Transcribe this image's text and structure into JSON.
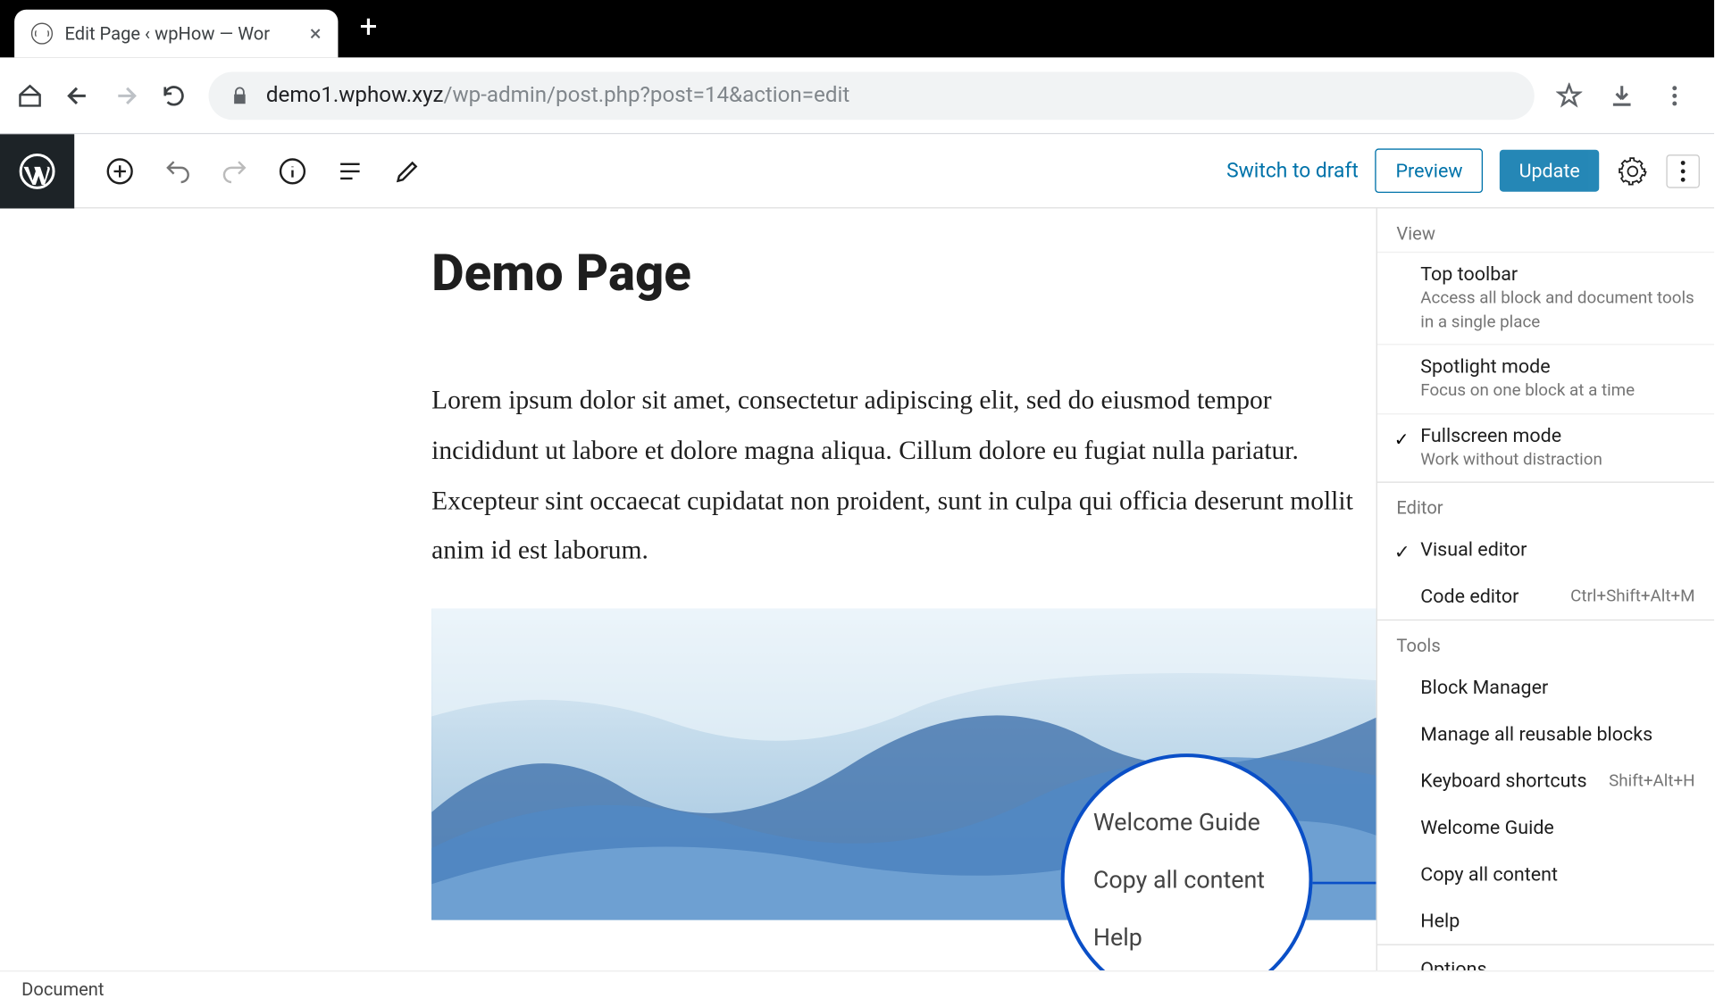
{
  "browser": {
    "tab_title": "Edit Page ‹ wpHow — Wor",
    "url_host": "demo1.wphow.xyz",
    "url_path": "/wp-admin/post.php?post=14&action=edit"
  },
  "toolbar": {
    "switch_to_draft": "Switch to draft",
    "preview": "Preview",
    "update": "Update"
  },
  "page": {
    "title": "Demo Page",
    "body": "Lorem ipsum dolor sit amet, consectetur adipiscing elit, sed do eiusmod tempor incididunt ut labore et dolore magna aliqua. Cillum dolore eu fugiat nulla pariatur. Excepteur sint occaecat cupidatat non proident, sunt in culpa qui officia deserunt mollit anim id est laborum."
  },
  "options_menu": {
    "view_label": "View",
    "top_toolbar": {
      "title": "Top toolbar",
      "desc": "Access all block and document tools in a single place"
    },
    "spotlight": {
      "title": "Spotlight mode",
      "desc": "Focus on one block at a time"
    },
    "fullscreen": {
      "title": "Fullscreen mode",
      "desc": "Work without distraction"
    },
    "editor_label": "Editor",
    "visual_editor": "Visual editor",
    "code_editor": "Code editor",
    "code_editor_shortcut": "Ctrl+Shift+Alt+M",
    "tools_label": "Tools",
    "block_manager": "Block Manager",
    "manage_reusable": "Manage all reusable blocks",
    "keyboard_shortcuts": "Keyboard shortcuts",
    "keyboard_shortcuts_key": "Shift+Alt+H",
    "welcome_guide": "Welcome Guide",
    "copy_all": "Copy all content",
    "help": "Help",
    "options_label": "Options"
  },
  "magnifier": {
    "welcome": "Welcome Guide",
    "copy": "Copy all content",
    "help": "Help"
  },
  "status": {
    "document": "Document"
  }
}
